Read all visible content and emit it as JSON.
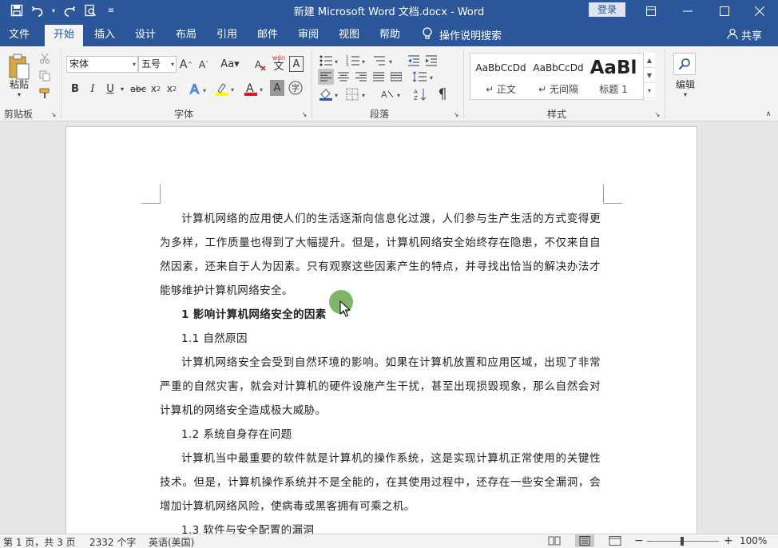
{
  "titlebar": {
    "title": "新建 Microsoft Word 文档.docx  -  Word",
    "login": "登录",
    "icons": [
      "save-icon",
      "undo-icon",
      "redo-icon",
      "print-preview-icon",
      "customize-qat-icon"
    ]
  },
  "tabs": [
    "文件",
    "开始",
    "插入",
    "设计",
    "布局",
    "引用",
    "邮件",
    "审阅",
    "视图",
    "帮助"
  ],
  "active_tab": "开始",
  "tell_me": "操作说明搜索",
  "share": "共享",
  "ribbon": {
    "clipboard": {
      "paste": "粘贴",
      "label": "剪贴板"
    },
    "font": {
      "name": "宋体",
      "size": "五号",
      "label": "字体",
      "pinyin": "wén",
      "char_border": "A"
    },
    "paragraph": {
      "label": "段落"
    },
    "styles": {
      "label": "样式",
      "items": [
        {
          "preview": "AaBbCcDd",
          "name": "↵ 正文"
        },
        {
          "preview": "AaBbCcDd",
          "name": "↵ 无间隔"
        },
        {
          "preview": "AaBl",
          "name": "标题 1"
        }
      ]
    },
    "editing": {
      "label": "编辑"
    }
  },
  "document": {
    "p1": "计算机网络的应用使人们的生活逐渐向信息化过渡，人们参与生产生活的方式变得更为多样，工作质量也得到了大幅提升。但是，计算机网络安全始终存在隐患，不仅来自自然因素，还来自于人为因素。只有观察这些因素产生的特点，并寻找出恰当的解决办法才能够维护计算机网络安全。",
    "h1": "1 影响计算机网络安全的因素",
    "s1": "1.1 自然原因",
    "p2": "计算机网络安全会受到自然环境的影响。如果在计算机放置和应用区域，出现了非常严重的自然灾害，就会对计算机的硬件设施产生干扰，甚至出现损毁现象，那么自然会对计算机的网络安全造成极大威胁。",
    "s2": "1.2 系统自身存在问题",
    "p3": "计算机当中最重要的软件就是计算机的操作系统，这是实现计算机正常使用的关键性技术。但是，计算机操作系统并不是全能的，在其使用过程中，还存在一些安全漏洞，会增加计算机网络风险，使病毒或黑客拥有可乘之机。",
    "s3": "1.3 软件与安全配置的漏洞"
  },
  "status": {
    "page": "第 1 页，共 3 页",
    "words": "2332 个字",
    "language": "英语(美国)",
    "zoom": "100%"
  }
}
